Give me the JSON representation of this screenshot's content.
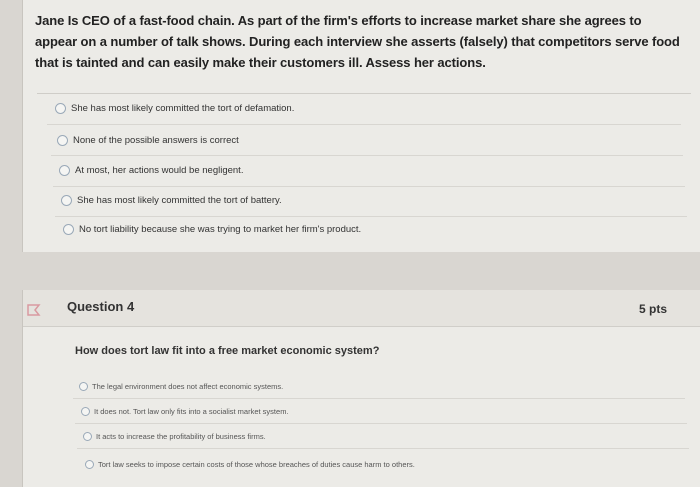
{
  "question3": {
    "text": "Jane Is CEO of a fast-food chain. As part of the firm's efforts to increase market share she agrees to appear on a number of talk shows. During each interview she asserts (falsely) that competitors serve food that is tainted and can easily make their customers ill. Assess her actions.",
    "answers": [
      "She has most likely committed the tort of defamation.",
      "None of the possible answers is correct",
      "At most, her actions would be negligent.",
      "She has most likely committed the tort of battery.",
      "No tort liability because she was trying to market her firm's product."
    ]
  },
  "question4": {
    "title": "Question 4",
    "points": "5 pts",
    "text": "How does tort law fit into a free market economic system?",
    "answers": [
      "The legal environment does not affect economic systems.",
      "It does not. Tort law only fits into a socialist market system.",
      "It acts to increase the profitability of business firms.",
      "Tort law seeks to impose certain costs of those whose breaches of duties cause harm to others."
    ]
  }
}
